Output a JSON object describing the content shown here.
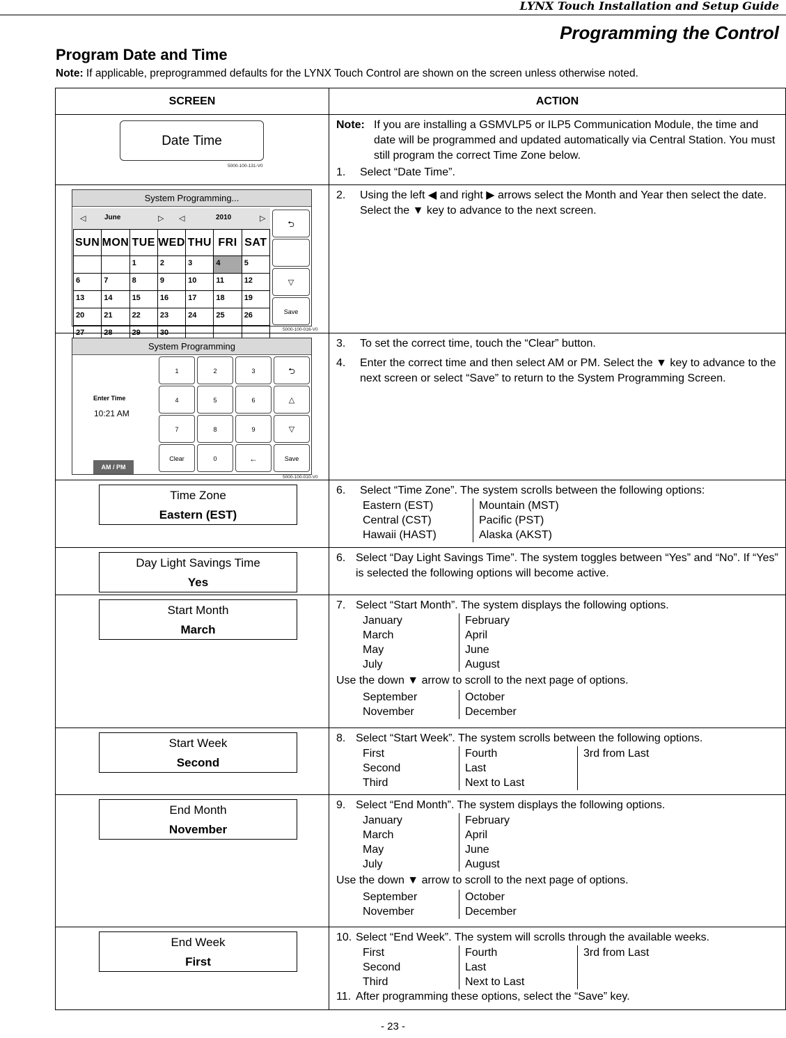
{
  "header": {
    "running_title": "LYNX Touch Installation and Setup Guide",
    "section_title": "Programming the Control",
    "page_title": "Program Date and Time",
    "note_label": "Note:",
    "note_text": " If applicable, preprogrammed defaults for the LYNX Touch Control are shown on the screen unless otherwise noted."
  },
  "table": {
    "col_screen": "SCREEN",
    "col_action": "ACTION"
  },
  "rows": {
    "date_time": {
      "button_label": "Date Time",
      "fig_id": "5000-100-131-V0",
      "note_label": "Note:",
      "note_text": "If you are installing a GSMVLP5 or ILP5 Communication Module, the time and date will be programmed and updated automatically via Central Station. You must still program the correct Time Zone below.",
      "step_num": "1.",
      "step_text": "Select “Date Time”."
    },
    "calendar": {
      "screen_title": "System Programming...",
      "month": "June",
      "year": "2010",
      "weekdays": [
        "SUN",
        "MON",
        "TUE",
        "WED",
        "THU",
        "FRI",
        "SAT"
      ],
      "weeks": [
        [
          "",
          "",
          "1",
          "2",
          "3",
          "4",
          "5"
        ],
        [
          "6",
          "7",
          "8",
          "9",
          "10",
          "11",
          "12"
        ],
        [
          "13",
          "14",
          "15",
          "16",
          "17",
          "18",
          "19"
        ],
        [
          "20",
          "21",
          "22",
          "23",
          "24",
          "25",
          "26"
        ],
        [
          "27",
          "28",
          "29",
          "30",
          "",
          "",
          ""
        ]
      ],
      "selected_day": "4",
      "save_label": "Save",
      "fig_id": "5000-100-016-V0",
      "step_num": "2.",
      "step_text": "Using the left ◀ and right ▶ arrows select the Month and Year then select the date. Select the ▼ key to advance to the next screen."
    },
    "time": {
      "screen_title": "System Programming",
      "enter_label": "Enter Time",
      "time_value": "10:21 AM",
      "ampm_label": "AM / PM",
      "keys": [
        "1",
        "2",
        "3",
        "4",
        "5",
        "6",
        "7",
        "8",
        "9",
        "Clear",
        "0"
      ],
      "save_label": "Save",
      "fig_id": "5000-100-010-V0",
      "steps": [
        {
          "num": "3.",
          "text": "To set the correct time, touch the “Clear” button."
        },
        {
          "num": "4.",
          "text": "Enter the correct time and then select AM or PM. Select the ▼ key to advance to the next screen or select “Save” to return to the System Programming Screen."
        }
      ]
    },
    "time_zone": {
      "label": "Time Zone",
      "value": "Eastern (EST)",
      "step_num": "6.",
      "step_text": "Select “Time Zone”. The system scrolls between the following options:",
      "options_col1": [
        "Eastern (EST)",
        "Central (CST)",
        "Hawaii (HAST)"
      ],
      "options_col2": [
        "Mountain (MST)",
        "Pacific (PST)",
        "Alaska (AKST)"
      ]
    },
    "dst": {
      "label": "Day Light Savings Time",
      "value": "Yes",
      "step_num": "6.",
      "step_text": "Select “Day Light Savings Time”. The system toggles between “Yes” and “No”. If “Yes” is selected the following options will become active."
    },
    "start_month": {
      "label": "Start Month",
      "value": "March",
      "step_num": "7.",
      "step_text": "Select “Start Month”. The system displays the following options.",
      "page1_col1": [
        "January",
        "March",
        "May",
        "July"
      ],
      "page1_col2": [
        "February",
        "April",
        "June",
        "August"
      ],
      "scroll_text": "Use the down ▼ arrow to scroll to the next page of options.",
      "page2_col1": [
        "September",
        "November"
      ],
      "page2_col2": [
        "October",
        "December"
      ]
    },
    "start_week": {
      "label": "Start Week",
      "value": "Second",
      "step_num": "8.",
      "step_text": "Select “Start Week”. The system scrolls between the following options.",
      "col1": [
        "First",
        "Second",
        "Third"
      ],
      "col2": [
        "Fourth",
        "Last",
        "Next to Last"
      ],
      "col3": [
        "3rd from Last"
      ]
    },
    "end_month": {
      "label": "End Month",
      "value": "November",
      "step_num": "9.",
      "step_text": "Select “End Month”. The system displays the following options.",
      "page1_col1": [
        "January",
        "March",
        "May",
        "July"
      ],
      "page1_col2": [
        "February",
        "April",
        "June",
        "August"
      ],
      "scroll_text": "Use the down ▼ arrow to scroll to the next page of options.",
      "page2_col1": [
        "September",
        "November"
      ],
      "page2_col2": [
        "October",
        "December"
      ]
    },
    "end_week": {
      "label": "End Week",
      "value": "First",
      "step_num": "10.",
      "step_text": "Select “End Week”. The system will scrolls through the available weeks.",
      "col1": [
        "First",
        "Second",
        "Third"
      ],
      "col2": [
        "Fourth",
        "Last",
        "Next to Last"
      ],
      "col3": [
        "3rd from Last"
      ],
      "final_num": "11.",
      "final_text": "After programming these options, select the “Save” key."
    }
  },
  "footer": {
    "page_number": "- 23 -"
  }
}
